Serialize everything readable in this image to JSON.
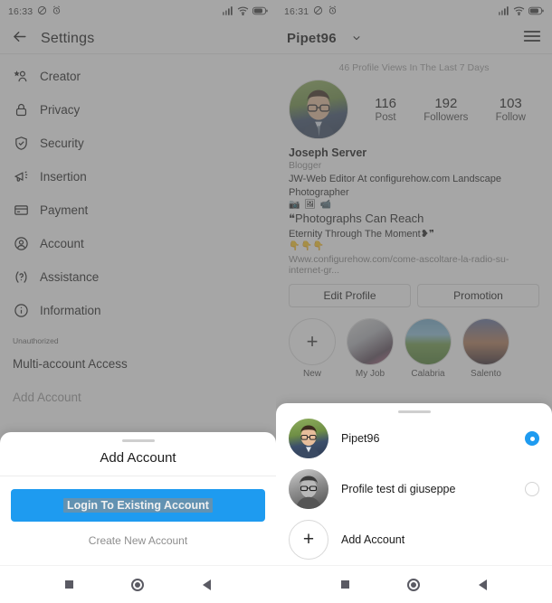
{
  "left": {
    "status": {
      "time": "16:33",
      "icons": [
        "no-sound-icon",
        "alarm-icon",
        "signal-icon",
        "wifi-icon",
        "battery-icon"
      ]
    },
    "appbar": {
      "back_icon": "back-arrow-icon",
      "title": "Settings"
    },
    "settings_items": [
      {
        "label": "Creator",
        "icon": "creator-person-star-icon"
      },
      {
        "label": "Privacy",
        "icon": "lock-icon"
      },
      {
        "label": "Security",
        "icon": "shield-check-icon"
      },
      {
        "label": "Insertion",
        "icon": "megaphone-icon"
      },
      {
        "label": "Payment",
        "icon": "credit-card-icon"
      },
      {
        "label": "Account",
        "icon": "account-circle-icon"
      },
      {
        "label": "Assistance",
        "icon": "help-question-icon"
      },
      {
        "label": "Information",
        "icon": "info-circle-icon"
      }
    ],
    "section_header": "Unauthorized",
    "multi_account": "Multi-account Access",
    "add_account": "Add Account",
    "sheet": {
      "title": "Add Account",
      "primary_button": "Login To Existing Account",
      "secondary_link": "Create New Account",
      "primary_color": "#1e9bf0"
    }
  },
  "right": {
    "status": {
      "time": "16:31",
      "icons": [
        "no-sound-icon",
        "alarm-icon",
        "signal-icon",
        "wifi-icon",
        "battery-icon"
      ]
    },
    "appbar": {
      "username": "Pipet96",
      "chevron_icon": "chevron-down-icon",
      "menu_icon": "hamburger-menu-icon"
    },
    "views_note": "46 Profile Views In The Last 7 Days",
    "stats": [
      {
        "number": "116",
        "label": "Post"
      },
      {
        "number": "192",
        "label": "Followers"
      },
      {
        "number": "103",
        "label": "Follow"
      }
    ],
    "bio": {
      "name": "Joseph Server",
      "category": "Blogger",
      "line1": "JW-Web Editor At configurehow.com Landscape Photographer",
      "emoji_row1": "📷 🖼 📹",
      "quote_line1": "❝Photographs Can Reach",
      "quote_line2": "Eternity Through The Moment❥❞",
      "emoji_row2": "👇👇👇",
      "url": "Www.configurehow.com/come-ascoltare-la-radio-su-internet-gr..."
    },
    "profile_buttons": [
      "Edit Profile",
      "Promotion"
    ],
    "highlights": [
      {
        "label": "New",
        "icon": "plus-icon"
      },
      {
        "label": "My Job",
        "icon": "highlight-thumb"
      },
      {
        "label": "Calabria",
        "icon": "highlight-thumb"
      },
      {
        "label": "Salento",
        "icon": "highlight-thumb"
      }
    ],
    "account_sheet": {
      "accounts": [
        {
          "name": "Pipet96",
          "selected": true
        },
        {
          "name": "Profile test di giuseppe",
          "selected": false
        }
      ],
      "add_account": "Add Account",
      "accent_color": "#1e9bf0"
    }
  },
  "navbar": {
    "recents_icon": "square-recents-icon",
    "home_icon": "circle-home-icon",
    "back_icon": "triangle-back-icon"
  }
}
